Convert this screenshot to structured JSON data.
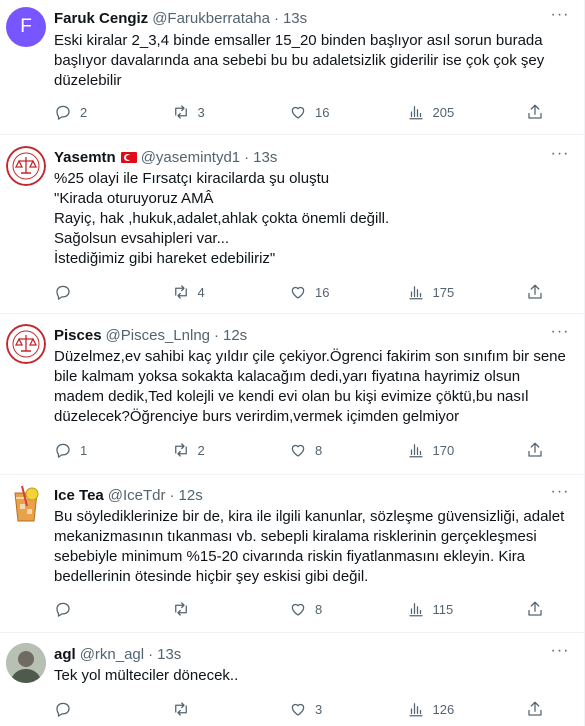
{
  "tweets": [
    {
      "avatar_letter": "F",
      "name": "Faruk Cengiz",
      "handle": "@Farukberrataha",
      "time": "13s",
      "text": "Eski kiralar 2_3,4 binde emsaller 15_20 binden başlıyor asıl sorun burada başlıyor davalarında ana sebebi bu bu adaletsizlik giderilir ise çok çok şey düzelebilir",
      "replies": "2",
      "retweets": "3",
      "likes": "16",
      "views": "205"
    },
    {
      "name": "Yasemtn",
      "handle": "@yasemintyd1",
      "time": "13s",
      "text": "%25 olayi ile Fırsatçı kiracilarda şu oluştu\n\"Kirada oturuyoruz AMÂ\nRayiç, hak ,hukuk,adalet,ahlak çokta önemli değill.\nSağolsun evsahipleri var...\nİstediğimiz gibi hareket edebiliriz\"",
      "replies": "",
      "retweets": "4",
      "likes": "16",
      "views": "175"
    },
    {
      "name": "Pisces",
      "handle": "@Pisces_Lnlng",
      "time": "12s",
      "text": "Düzelmez,ev sahibi kaç yıldır çile çekiyor.Ögrenci fakirim son sınıfım bir sene bile kalmam yoksa sokakta kalacağım dedi,yarı fiyatına hayrimiz olsun madem dedik,Ted kolejli ve kendi evi olan bu kişi evimize çöktü,bu nasıl düzelecek?Öğrenciye burs verirdim,vermek içimden gelmiyor",
      "replies": "1",
      "retweets": "2",
      "likes": "8",
      "views": "170"
    },
    {
      "name": "Ice Tea",
      "handle": "@IceTdr",
      "time": "12s",
      "text": "Bu söylediklerinize bir de, kira ile ilgili kanunlar, sözleşme güvensizliği, adalet mekanizmasının tıkanması vb. sebepli kiralama risklerinin gerçekleşmesi sebebiyle minimum %15-20 civarında riskin fiyatlanmasını ekleyin. Kira bedellerinin ötesinde hiçbir şey eskisi gibi değil.",
      "replies": "",
      "retweets": "",
      "likes": "8",
      "views": "115"
    },
    {
      "name": "agl",
      "handle": "@rkn_agl",
      "time": "13s",
      "text": "Tek yol mülteciler dönecek..",
      "replies": "",
      "retweets": "",
      "likes": "3",
      "views": "126"
    }
  ],
  "ui": {
    "separator": "·",
    "more": "···"
  },
  "icons": [
    "reply-icon",
    "retweet-icon",
    "like-icon",
    "views-icon",
    "share-icon",
    "more-icon"
  ],
  "colors": {
    "text": "#0f1419",
    "secondary": "#536471",
    "border": "#eff3f4",
    "avatar_f": "#7856ff"
  }
}
